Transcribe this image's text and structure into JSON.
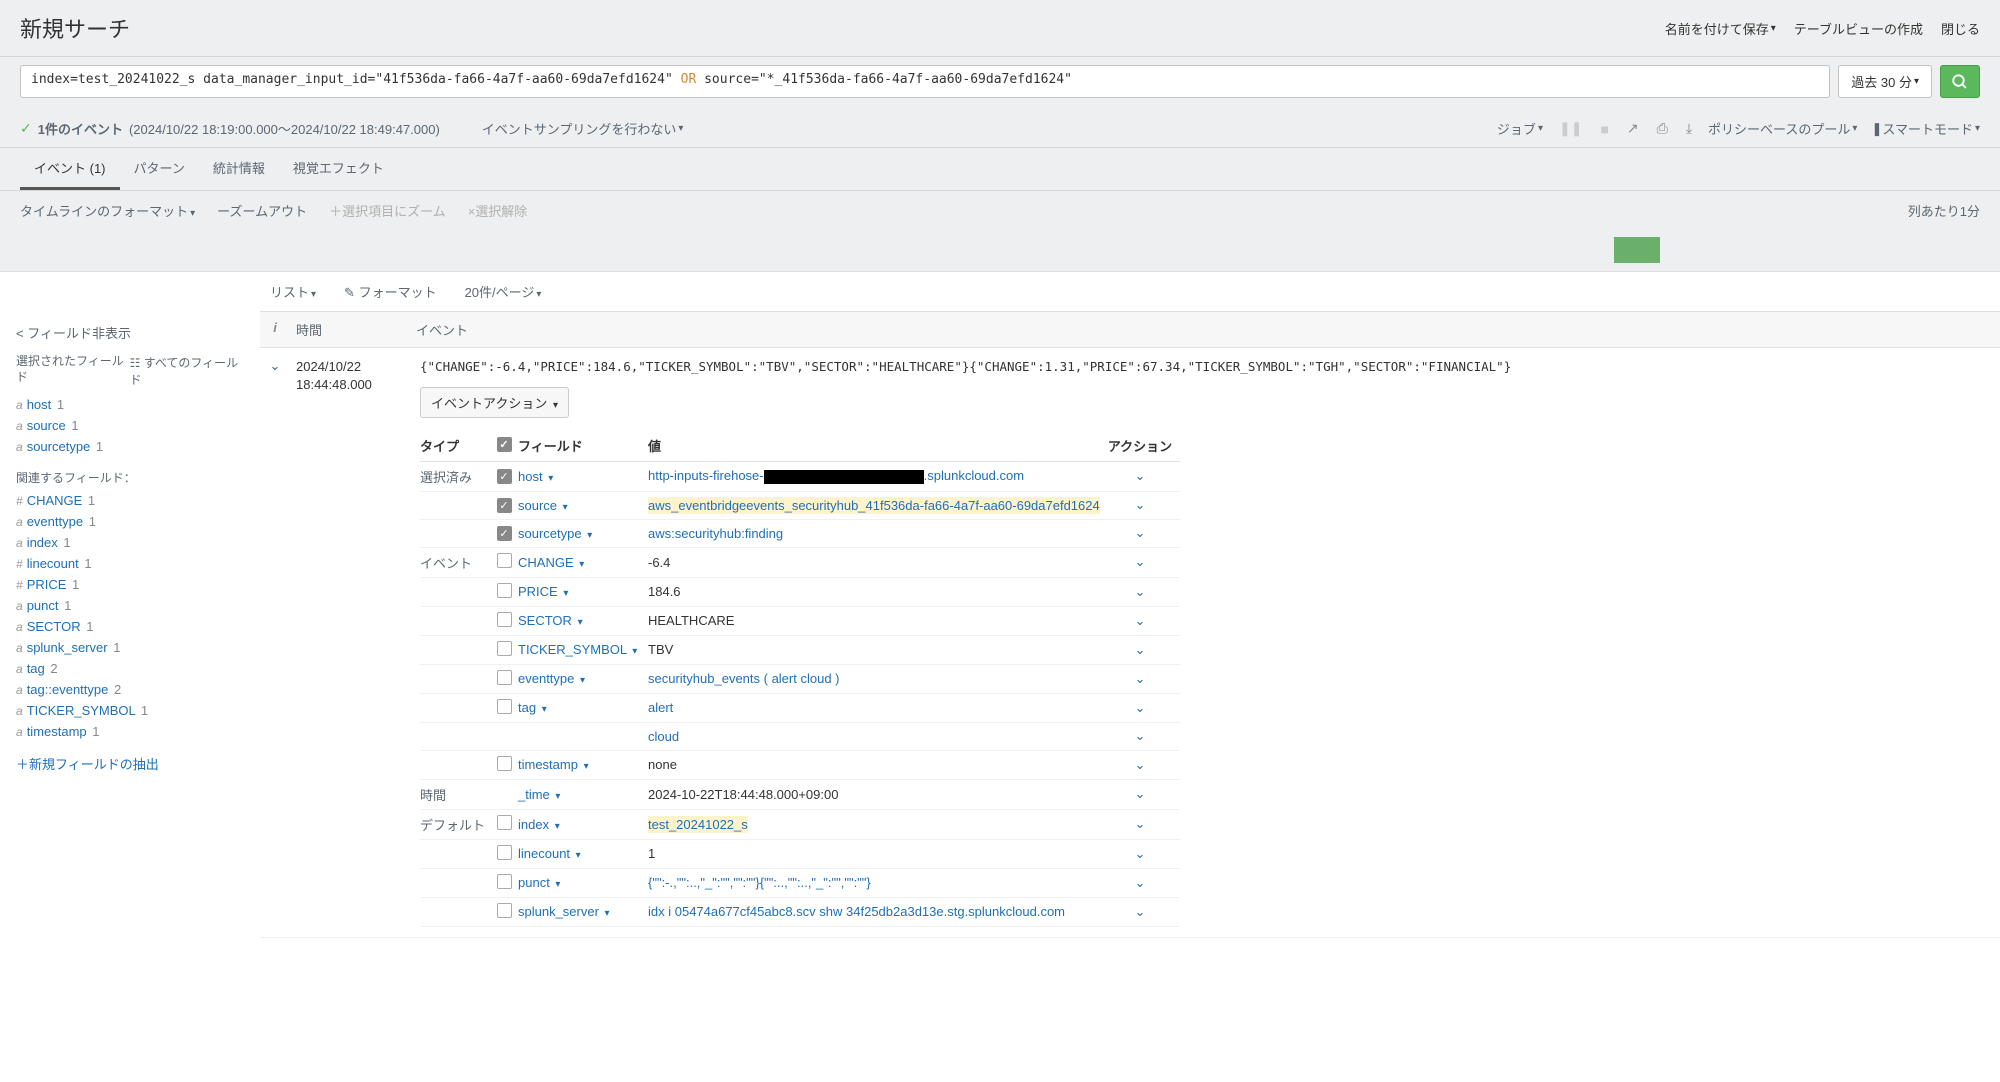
{
  "header": {
    "title": "新規サーチ",
    "save_as": "名前を付けて保存",
    "create_table": "テーブルビューの作成",
    "close": "閉じる"
  },
  "search": {
    "query_part1": "index=test_20241022_s data_manager_input_id=\"41f536da-fa66-4a7f-aa60-69da7efd1624\" ",
    "query_or": "OR",
    "query_part2": " source=\"*_41f536da-fa66-4a7f-aa60-69da7efd1624\"",
    "time_range": "過去 30 分"
  },
  "status": {
    "events_text": "1件のイベント",
    "time_range": "(2024/10/22 18:19:00.000～2024/10/22 18:49:47.000)",
    "sampling": "イベントサンプリングを行わない",
    "job": "ジョブ",
    "policy": "ポリシーベースのプール",
    "smart_mode": "スマートモード"
  },
  "tabs": {
    "events": "イベント (1)",
    "patterns": "パターン",
    "statistics": "統計情報",
    "visualization": "視覚エフェクト"
  },
  "timeline": {
    "format": "タイムラインのフォーマット",
    "zoom_out": "ーズームアウト",
    "zoom_sel": "＋選択項目にズーム",
    "deselect": "×選択解除",
    "per_col": "列あたり1分"
  },
  "format_bar": {
    "list": "リスト",
    "format": "フォーマット",
    "per_page": "20件/ページ"
  },
  "sidebar": {
    "hide_fields": "< フィールド非表示",
    "selected_fields": "選択されたフィールド",
    "all_fields": "☷ すべてのフィールド",
    "interesting": "関連するフィールド：",
    "extract": "＋新規フィールドの抽出",
    "selected": [
      {
        "type": "a",
        "name": "host",
        "count": "1"
      },
      {
        "type": "a",
        "name": "source",
        "count": "1"
      },
      {
        "type": "a",
        "name": "sourcetype",
        "count": "1"
      }
    ],
    "related": [
      {
        "type": "#",
        "name": "CHANGE",
        "count": "1"
      },
      {
        "type": "a",
        "name": "eventtype",
        "count": "1"
      },
      {
        "type": "a",
        "name": "index",
        "count": "1"
      },
      {
        "type": "#",
        "name": "linecount",
        "count": "1"
      },
      {
        "type": "#",
        "name": "PRICE",
        "count": "1"
      },
      {
        "type": "a",
        "name": "punct",
        "count": "1"
      },
      {
        "type": "a",
        "name": "SECTOR",
        "count": "1"
      },
      {
        "type": "a",
        "name": "splunk_server",
        "count": "1"
      },
      {
        "type": "a",
        "name": "tag",
        "count": "2"
      },
      {
        "type": "a",
        "name": "tag::eventtype",
        "count": "2"
      },
      {
        "type": "a",
        "name": "TICKER_SYMBOL",
        "count": "1"
      },
      {
        "type": "a",
        "name": "timestamp",
        "count": "1"
      }
    ]
  },
  "events_header": {
    "time": "時間",
    "event": "イベント"
  },
  "event": {
    "date": "2024/10/22",
    "time": "18:44:48.000",
    "raw": "{\"CHANGE\":-6.4,\"PRICE\":184.6,\"TICKER_SYMBOL\":\"TBV\",\"SECTOR\":\"HEALTHCARE\"}{\"CHANGE\":1.31,\"PRICE\":67.34,\"TICKER_SYMBOL\":\"TGH\",\"SECTOR\":\"FINANCIAL\"}",
    "action_btn": "イベントアクション"
  },
  "ftable": {
    "h_type": "タイプ",
    "h_field": "フィールド",
    "h_value": "値",
    "h_action": "アクション",
    "groups": {
      "selected": "選択済み",
      "event": "イベント",
      "time": "時間",
      "default": "デフォルト"
    },
    "rows": [
      {
        "group": "selected",
        "checked": true,
        "field": "host",
        "value_pre": "http-inputs-firehose-",
        "value_post": ".splunkcloud.com",
        "link": true,
        "redact": true
      },
      {
        "group": "",
        "checked": true,
        "field": "source",
        "value": "aws_eventbridgeevents_securityhub_41f536da-fa66-4a7f-aa60-69da7efd1624",
        "link": true,
        "hl": true
      },
      {
        "group": "",
        "checked": true,
        "field": "sourcetype",
        "value": "aws:securityhub:finding",
        "link": true
      },
      {
        "group": "event",
        "checked": false,
        "field": "CHANGE",
        "value": "-6.4"
      },
      {
        "group": "",
        "checked": false,
        "field": "PRICE",
        "value": "184.6"
      },
      {
        "group": "",
        "checked": false,
        "field": "SECTOR",
        "value": "HEALTHCARE"
      },
      {
        "group": "",
        "checked": false,
        "field": "TICKER_SYMBOL",
        "value": "TBV"
      },
      {
        "group": "",
        "checked": false,
        "field": "eventtype",
        "value": "securityhub_events ( alert  cloud )",
        "link": true
      },
      {
        "group": "",
        "checked": false,
        "field": "tag",
        "value": "alert",
        "link": true
      },
      {
        "group": "",
        "checked": false,
        "nofield": true,
        "value": "cloud",
        "link": true
      },
      {
        "group": "",
        "checked": false,
        "field": "timestamp",
        "value": "none"
      },
      {
        "group": "time",
        "nochk": true,
        "field": "_time",
        "value": "2024-10-22T18:44:48.000+09:00"
      },
      {
        "group": "default",
        "checked": false,
        "field": "index",
        "value": "test_20241022_s",
        "link": true,
        "hl": true
      },
      {
        "group": "",
        "checked": false,
        "field": "linecount",
        "value": "1"
      },
      {
        "group": "",
        "checked": false,
        "field": "punct",
        "value": "{\"\":-.,\"\":..,\"_\":\"\",\"\":\"\"}{\"\":..,\"\":..,\"_\":\"\",\"\":\"\"}",
        "link": true
      },
      {
        "group": "",
        "checked": false,
        "field": "splunk_server",
        "value": "idx i 05474a677cf45abc8.scv shw 34f25db2a3d13e.stg.splunkcloud.com",
        "link": true
      }
    ]
  }
}
